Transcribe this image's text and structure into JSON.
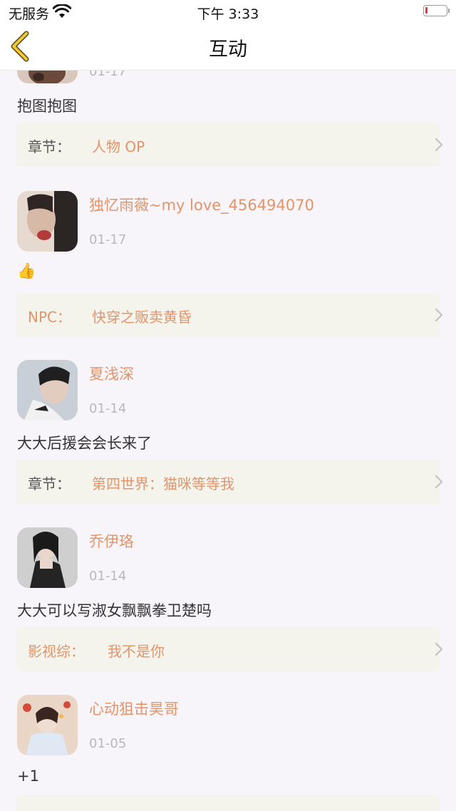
{
  "status_bar": {
    "carrier": "无服务",
    "time": "下午 3:33",
    "battery_level": 0.1
  },
  "nav": {
    "title": "互动"
  },
  "partial_top": {
    "date": "01-17",
    "comment": "抱图抱图",
    "source_type": "章节：",
    "source_name": "人物 OP"
  },
  "comments": [
    {
      "username": "独忆雨薇~my love_456494070",
      "date": "01-17",
      "content": "👍",
      "source_type": "NPC：",
      "source_name": "快穿之贩卖黄昏"
    },
    {
      "username": "夏浅深",
      "date": "01-14",
      "content": "大大后援会会长来了",
      "source_type": "章节：",
      "source_name": "第四世界：猫咪等等我"
    },
    {
      "username": "乔伊珞",
      "date": "01-14",
      "content": "大大可以写淑女飘飘拳卫楚吗",
      "source_type": "影视综：",
      "source_name": "我不是你"
    },
    {
      "username": "心动狙击昊哥",
      "date": "01-05",
      "content": "+1"
    }
  ],
  "colors": {
    "accent": "#e2946a",
    "card_bg": "#f4f3ec",
    "page_bg": "#f7f5f9",
    "back_arrow": "#f0c832"
  }
}
